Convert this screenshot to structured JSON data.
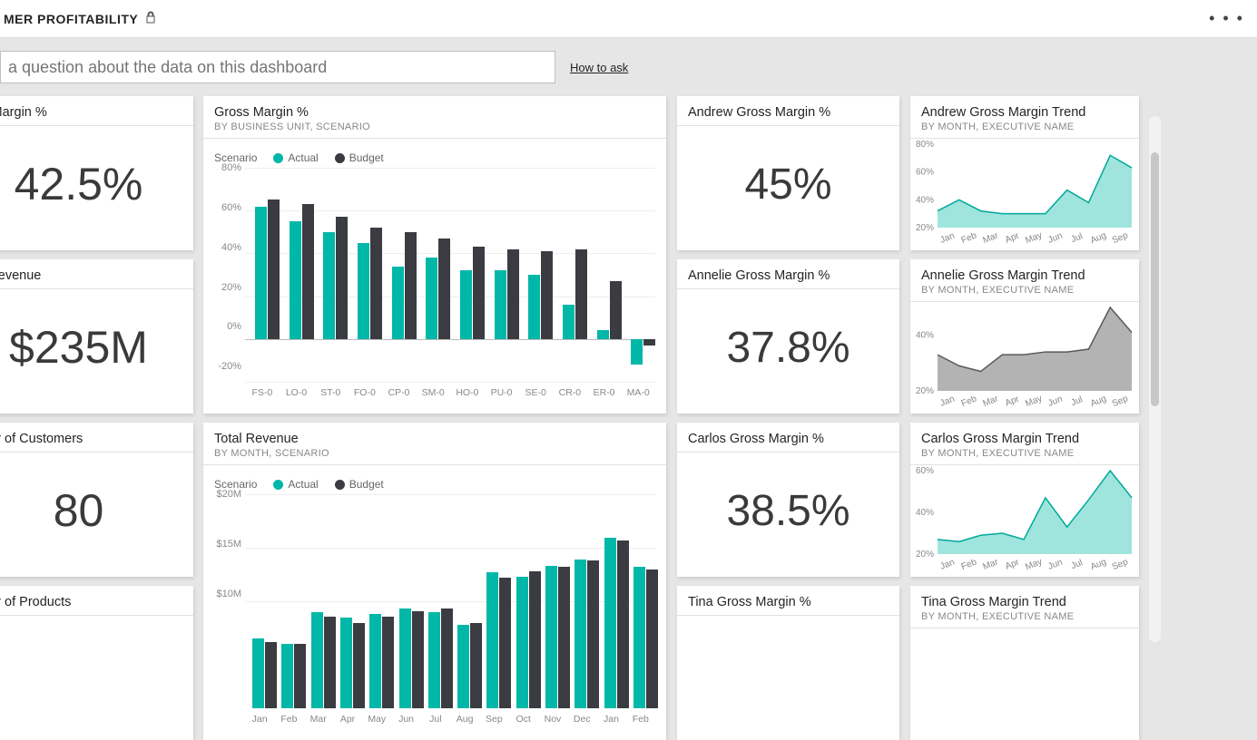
{
  "header": {
    "title": "MER PROFITABILITY",
    "lock_icon": "lock-icon",
    "more_icon": "more-icon"
  },
  "qa": {
    "placeholder": "a question about the data on this dashboard",
    "howto": "How to ask"
  },
  "colors": {
    "actual": "#00b7a8",
    "budget": "#3a3c42",
    "gray": "#8a8a8a"
  },
  "tiles": {
    "gm_overall": {
      "title": "ss Margin %",
      "value": "42.5%"
    },
    "revenue_overall": {
      "title": "al Revenue",
      "value": "$235M"
    },
    "customers": {
      "title": "nber of Customers",
      "value": "80"
    },
    "products": {
      "title": "nber of Products"
    },
    "gm_by_bu": {
      "title": "Gross Margin %",
      "sub": "BY BUSINESS UNIT, SCENARIO",
      "legend_label": "Scenario",
      "legend_actual": "Actual",
      "legend_budget": "Budget"
    },
    "rev_by_month": {
      "title": "Total Revenue",
      "sub": "BY MONTH, SCENARIO",
      "legend_label": "Scenario",
      "legend_actual": "Actual",
      "legend_budget": "Budget"
    },
    "andrew_gm": {
      "title": "Andrew Gross Margin %",
      "value": "45%"
    },
    "annelie_gm": {
      "title": "Annelie Gross Margin %",
      "value": "37.8%"
    },
    "carlos_gm": {
      "title": "Carlos Gross Margin %",
      "value": "38.5%"
    },
    "tina_gm": {
      "title": "Tina Gross Margin %"
    },
    "andrew_trend": {
      "title": "Andrew Gross Margin Trend",
      "sub": "BY MONTH, EXECUTIVE NAME"
    },
    "annelie_trend": {
      "title": "Annelie Gross Margin Trend",
      "sub": "BY MONTH, EXECUTIVE NAME"
    },
    "carlos_trend": {
      "title": "Carlos Gross Margin Trend",
      "sub": "BY MONTH, EXECUTIVE NAME"
    },
    "tina_trend": {
      "title": "Tina Gross Margin Trend",
      "sub": "BY MONTH, EXECUTIVE NAME"
    }
  },
  "chart_data": [
    {
      "id": "gm_by_bu",
      "type": "bar",
      "title": "Gross Margin %",
      "xlabel": "",
      "ylabel": "",
      "ylim": [
        -20,
        80
      ],
      "yticks": [
        -20,
        0,
        20,
        40,
        60,
        80
      ],
      "categories": [
        "FS-0",
        "LO-0",
        "ST-0",
        "FO-0",
        "CP-0",
        "SM-0",
        "HO-0",
        "PU-0",
        "SE-0",
        "CR-0",
        "ER-0",
        "MA-0"
      ],
      "series": [
        {
          "name": "Actual",
          "color": "#00b7a8",
          "values": [
            62,
            55,
            50,
            45,
            34,
            38,
            32,
            32,
            30,
            16,
            4,
            -12
          ]
        },
        {
          "name": "Budget",
          "color": "#3a3c42",
          "values": [
            65,
            63,
            57,
            52,
            50,
            47,
            43,
            42,
            41,
            42,
            27,
            -3
          ]
        }
      ]
    },
    {
      "id": "rev_by_month",
      "type": "bar",
      "title": "Total Revenue",
      "xlabel": "",
      "ylabel": "",
      "ylim": [
        0,
        20
      ],
      "yticks": [
        10,
        15,
        20
      ],
      "ytick_labels": [
        "$10M",
        "$15M",
        "$20M"
      ],
      "categories": [
        "Jan",
        "Feb",
        "Mar",
        "Apr",
        "May",
        "Jun",
        "Jul",
        "Aug",
        "Sep",
        "Oct",
        "Nov",
        "Dec",
        "Jan",
        "Feb"
      ],
      "series": [
        {
          "name": "Actual",
          "color": "#00b7a8",
          "values": [
            6.5,
            6.0,
            9.0,
            8.5,
            8.8,
            9.3,
            9.0,
            7.8,
            12.7,
            12.3,
            13.3,
            13.9,
            15.9,
            13.2
          ]
        },
        {
          "name": "Budget",
          "color": "#3a3c42",
          "values": [
            6.2,
            6.0,
            8.6,
            8.0,
            8.6,
            9.1,
            9.3,
            8.0,
            12.2,
            12.8,
            13.2,
            13.8,
            15.7,
            13.0
          ]
        }
      ]
    },
    {
      "id": "andrew_trend",
      "type": "area",
      "title": "Andrew Gross Margin Trend",
      "ylim": [
        20,
        80
      ],
      "yticks": [
        20,
        40,
        60,
        80
      ],
      "categories": [
        "Jan",
        "Feb",
        "Mar",
        "Apr",
        "May",
        "Jun",
        "Jul",
        "Aug",
        "Sep"
      ],
      "series": [
        {
          "name": "Andrew",
          "color": "#7fdcd2",
          "values": [
            32,
            40,
            32,
            30,
            30,
            30,
            47,
            38,
            72,
            63
          ]
        }
      ]
    },
    {
      "id": "annelie_trend",
      "type": "area",
      "title": "Annelie Gross Margin Trend",
      "ylim": [
        20,
        50
      ],
      "yticks": [
        20,
        40
      ],
      "categories": [
        "Jan",
        "Feb",
        "Mar",
        "Apr",
        "May",
        "Jun",
        "Jul",
        "Aug",
        "Sep"
      ],
      "series": [
        {
          "name": "Annelie",
          "color": "#9a9a9a",
          "values": [
            33,
            29,
            27,
            33,
            33,
            34,
            34,
            35,
            50,
            41
          ]
        }
      ]
    },
    {
      "id": "carlos_trend",
      "type": "area",
      "title": "Carlos Gross Margin Trend",
      "ylim": [
        20,
        60
      ],
      "yticks": [
        20,
        40,
        60
      ],
      "categories": [
        "Jan",
        "Feb",
        "Mar",
        "Apr",
        "May",
        "Jun",
        "Jul",
        "Aug",
        "Sep"
      ],
      "series": [
        {
          "name": "Carlos",
          "color": "#7fdcd2",
          "values": [
            27,
            26,
            29,
            30,
            27,
            47,
            33,
            46,
            60,
            47
          ]
        }
      ]
    }
  ]
}
